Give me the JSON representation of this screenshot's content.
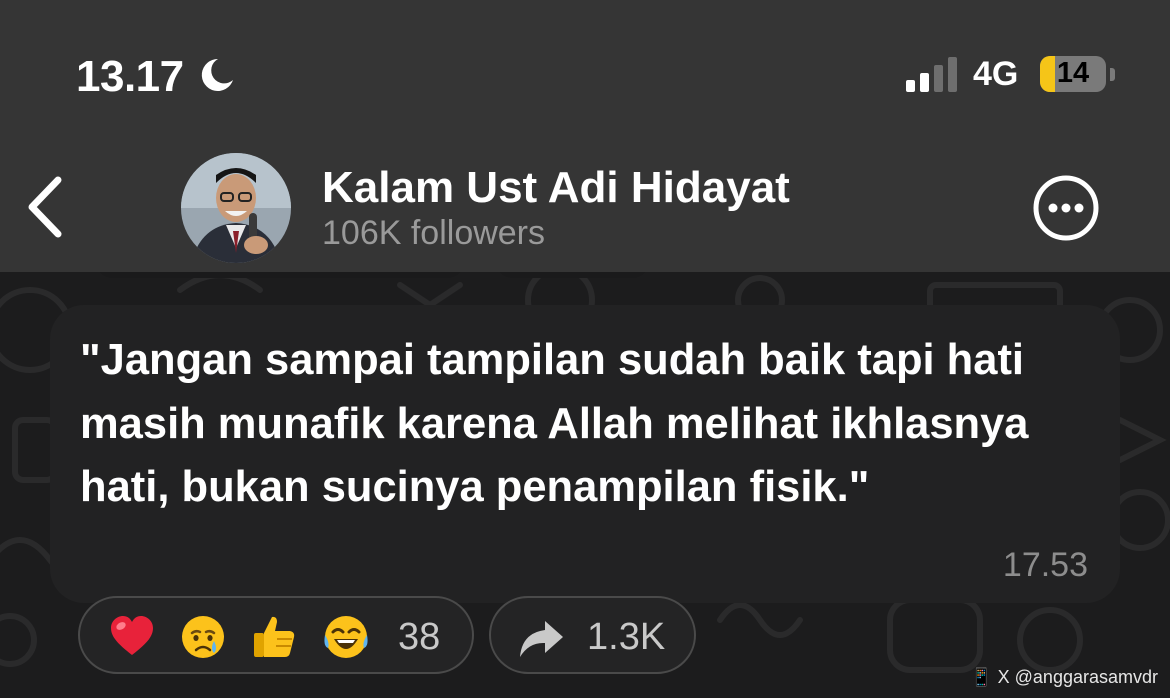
{
  "status_bar": {
    "time": "13.17",
    "network": "4G",
    "battery": "14",
    "battery_level_percent": 14
  },
  "header": {
    "title": "Kalam Ust Adi Hidayat",
    "subtitle": "106K followers"
  },
  "message": {
    "text": "\"Jangan sampai tampilan sudah baik tapi hati masih munafik karena Allah melihat ikhlasnya hati, bukan sucinya penampilan fisik.\"",
    "time": "17.53"
  },
  "reactions": {
    "emojis": [
      "red-heart",
      "crying-face",
      "thumbs-up",
      "tears-of-joy"
    ],
    "count": "38"
  },
  "forwards": {
    "count": "1.3K"
  },
  "watermark": "X @anggarasamvdr",
  "colors": {
    "header_bg": "#353535",
    "chat_bg": "#1c1c1d",
    "bubble_bg": "#222223",
    "battery_accent": "#f5c518"
  }
}
